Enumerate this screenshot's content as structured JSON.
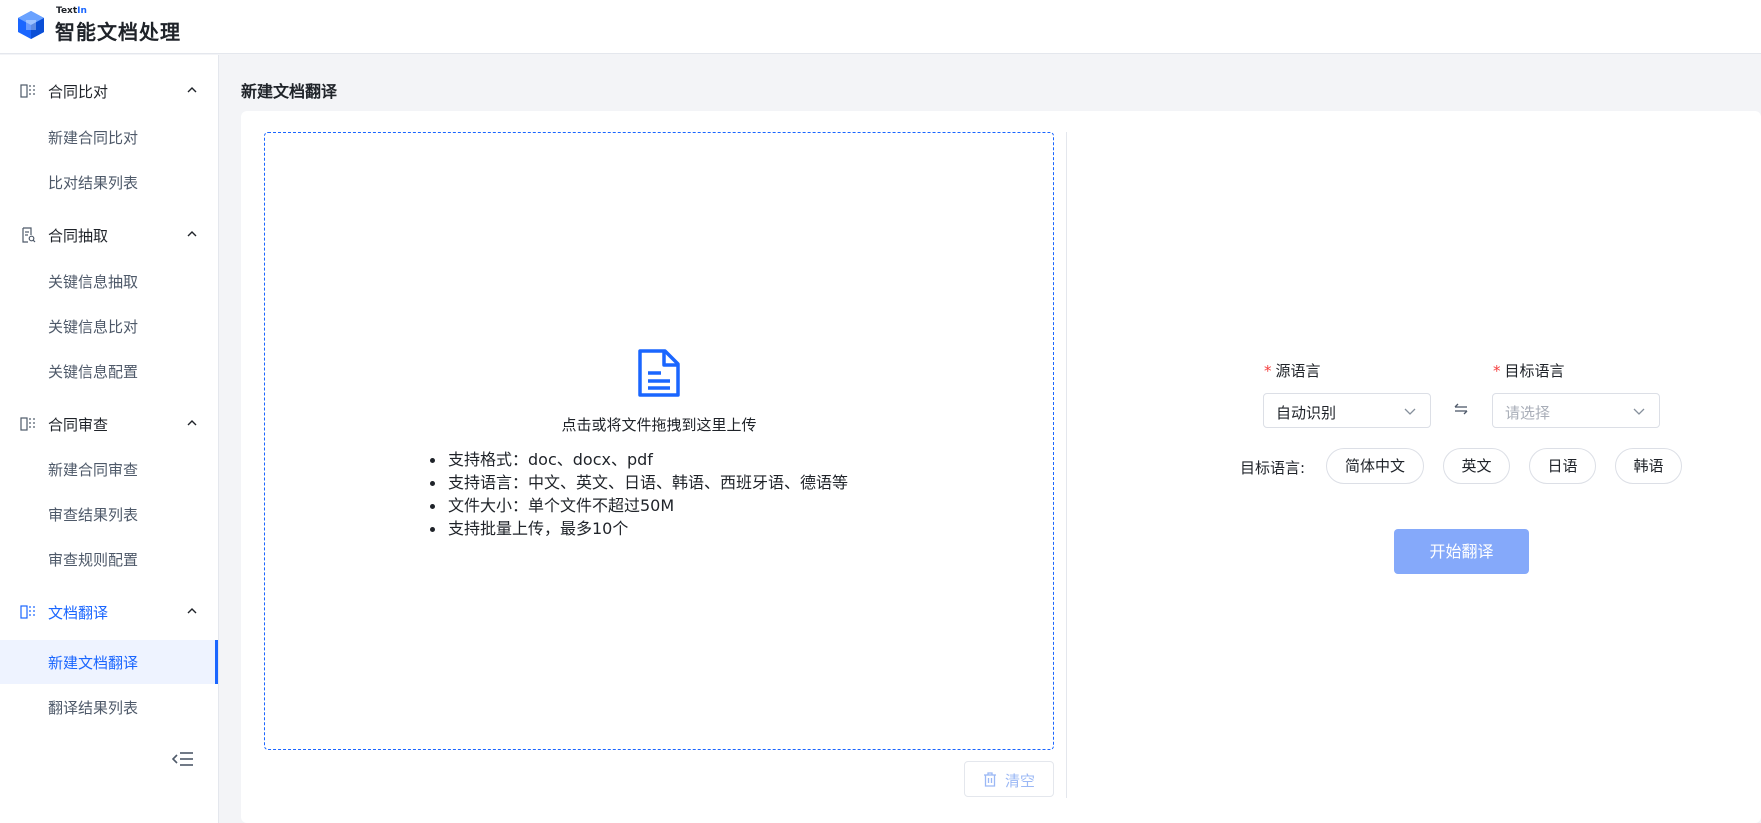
{
  "app": {
    "brand_small_prefix": "Text",
    "brand_small_suffix": "In",
    "title": "智能文档处理"
  },
  "sidebar": {
    "groups": [
      {
        "label": "合同比对",
        "icon": "split-panel-icon",
        "items": [
          "新建合同比对",
          "比对结果列表"
        ]
      },
      {
        "label": "合同抽取",
        "icon": "document-search-icon",
        "items": [
          "关键信息抽取",
          "关键信息比对",
          "关键信息配置"
        ]
      },
      {
        "label": "合同审查",
        "icon": "split-panel-icon",
        "items": [
          "新建合同审查",
          "审查结果列表",
          "审查规则配置"
        ]
      },
      {
        "label": "文档翻译",
        "icon": "split-panel-icon",
        "items": [
          "新建文档翻译",
          "翻译结果列表"
        ]
      }
    ],
    "active_group": "文档翻译",
    "selected_item": "新建文档翻译"
  },
  "main": {
    "page_title": "新建文档翻译",
    "upload": {
      "hint": "点击或将文件拖拽到这里上传",
      "rules": [
        "支持格式：doc、docx、pdf",
        "支持语言：中文、英文、日语、韩语、西班牙语、德语等",
        "文件大小：单个文件不超过50M",
        "支持批量上传，最多10个"
      ]
    },
    "clear_label": "清空",
    "source_language": {
      "label": "源语言",
      "value": "自动识别"
    },
    "target_language": {
      "label": "目标语言",
      "placeholder": "请选择"
    },
    "quick_target_label": "目标语言:",
    "quick_targets": [
      "简体中文",
      "英文",
      "日语",
      "韩语"
    ],
    "start_label": "开始翻译"
  },
  "colors": {
    "accent": "#1a66ff",
    "start_button_disabled": "#85a9fa",
    "required": "#f53f3f"
  }
}
